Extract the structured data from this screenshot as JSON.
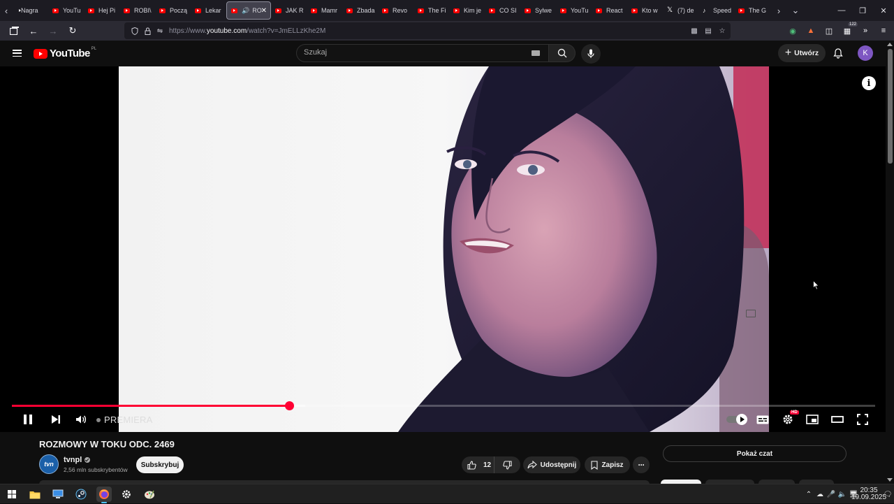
{
  "browser": {
    "tabs": [
      {
        "label": "Nagra",
        "favicon": "plain"
      },
      {
        "label": "YouTu",
        "favicon": "youtube-icon"
      },
      {
        "label": "Hej Pi",
        "favicon": "youtube-icon"
      },
      {
        "label": "ROBI\\",
        "favicon": "youtube-icon"
      },
      {
        "label": "Począ",
        "favicon": "youtube-icon"
      },
      {
        "label": "Lekar",
        "favicon": "youtube-icon"
      },
      {
        "label": "RO",
        "favicon": "youtube-icon",
        "active": true
      },
      {
        "label": "JAK R",
        "favicon": "youtube-icon"
      },
      {
        "label": "Mamr",
        "favicon": "youtube-icon"
      },
      {
        "label": "Zbada",
        "favicon": "youtube-icon"
      },
      {
        "label": "Revo",
        "favicon": "youtube-icon"
      },
      {
        "label": "The Fi",
        "favicon": "youtube-icon"
      },
      {
        "label": "Kim je",
        "favicon": "youtube-icon"
      },
      {
        "label": "CO SI",
        "favicon": "youtube-icon"
      },
      {
        "label": "Sylwe",
        "favicon": "youtube-icon"
      },
      {
        "label": "YouTu",
        "favicon": "youtube-icon"
      },
      {
        "label": "React",
        "favicon": "youtube-icon"
      },
      {
        "label": "Kto w",
        "favicon": "youtube-icon"
      },
      {
        "label": "(7) de",
        "favicon": "x-icon"
      },
      {
        "label": "Speed",
        "favicon": "tiktok-icon"
      },
      {
        "label": "The G",
        "favicon": "youtube-icon"
      }
    ],
    "url_prefix": "https://www.",
    "url_domain": "youtube.com",
    "url_rest": "/watch?v=JmELLzKhe2M",
    "extension_badge": "122"
  },
  "youtube": {
    "logo_text": "YouTube",
    "region": "PL",
    "search_placeholder": "Szukaj",
    "create_label": "Utwórz",
    "avatar_letter": "K"
  },
  "player": {
    "played_fraction": 0.321,
    "buffered_fraction": 0.34,
    "live_label": "PREMIERA",
    "quality_badge": "HD"
  },
  "video": {
    "title": "ROZMOWY W TOKU ODC. 2469",
    "channel_name": "tvnpl",
    "channel_avatar_text": "tvn",
    "subscribers": "2,56 mln subskrybentów",
    "subscribe_label": "Subskrybuj",
    "likes": "12",
    "share_label": "Udostępnij",
    "save_label": "Zapisz",
    "show_chat_label": "Pokaż czat"
  },
  "taskbar": {
    "time": "20:35",
    "date": "19.09.2025"
  },
  "colors": {
    "yt_red": "#ff0000",
    "progress_red": "#ff0033",
    "avatar_purple": "#7e57c2"
  }
}
